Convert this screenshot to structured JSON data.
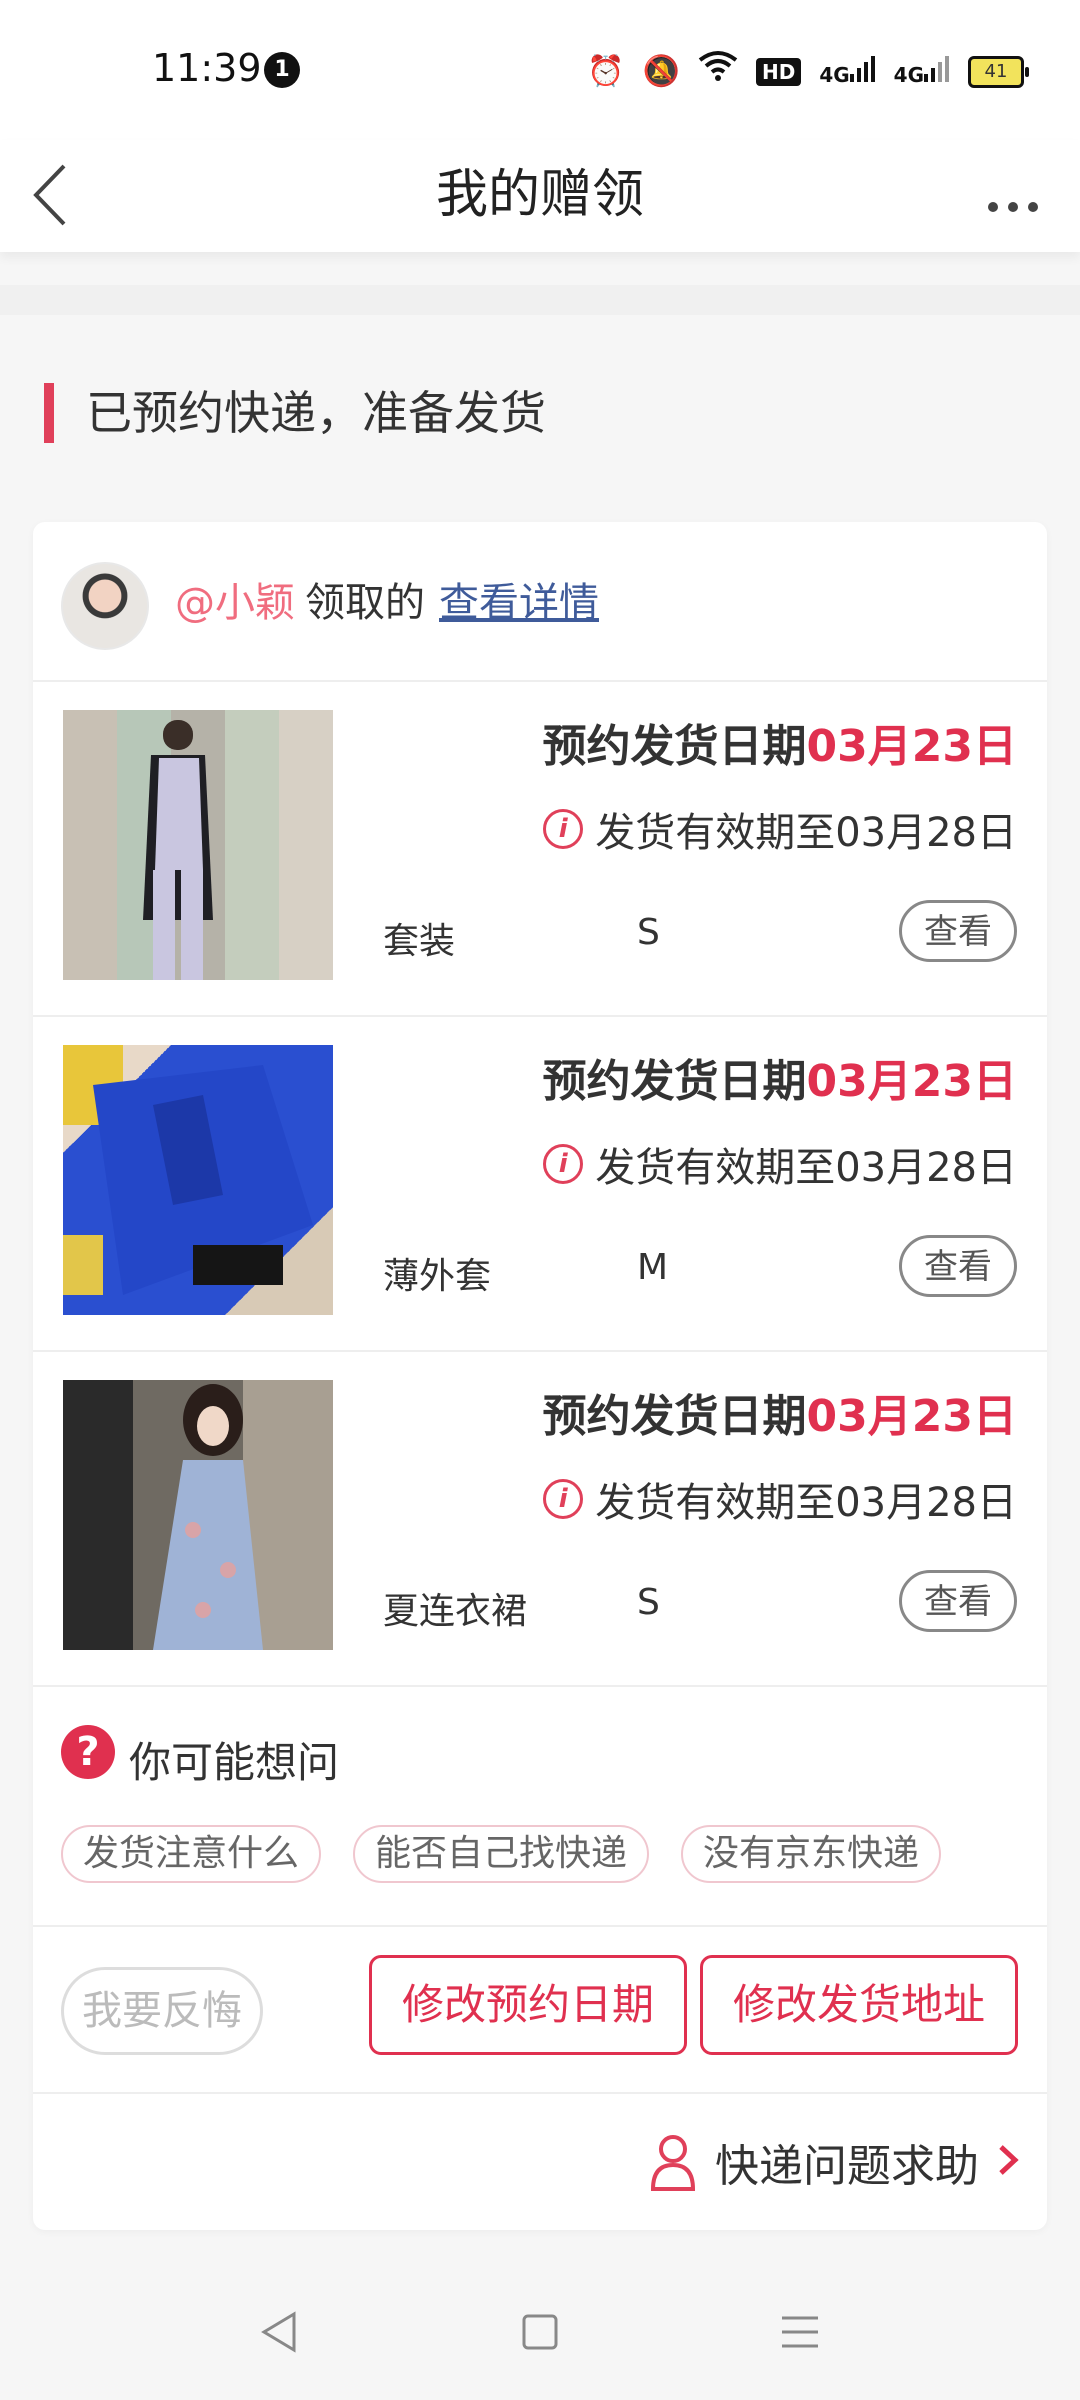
{
  "status": {
    "time": "11:39",
    "notif_count": "1",
    "network": "4G",
    "network2": "4G",
    "hd": "HD",
    "battery": "41"
  },
  "header": {
    "title": "我的赠领"
  },
  "section": {
    "title": "已预约快递，准备发货"
  },
  "claim": {
    "user": "@小颖",
    "middle": "领取的",
    "link": "查看详情"
  },
  "items": [
    {
      "ship_label": "预约发货日期",
      "ship_date": "03月23日",
      "valid": "发货有效期至03月28日",
      "name": "套装",
      "size": "S",
      "view": "查看"
    },
    {
      "ship_label": "预约发货日期",
      "ship_date": "03月23日",
      "valid": "发货有效期至03月28日",
      "name": "薄外套",
      "size": "M",
      "view": "查看"
    },
    {
      "ship_label": "预约发货日期",
      "ship_date": "03月23日",
      "valid": "发货有效期至03月28日",
      "name": "夏连衣裙",
      "size": "S",
      "view": "查看"
    }
  ],
  "faq": {
    "title": "你可能想问",
    "chips": [
      "发货注意什么",
      "能否自己找快递",
      "没有京东快递"
    ]
  },
  "actions": {
    "regret": "我要反悔",
    "change_date": "修改预约日期",
    "change_address": "修改发货地址"
  },
  "help": {
    "label": "快递问题求助"
  },
  "colors": {
    "accent": "#e0304f",
    "link": "#3f5b9a",
    "user": "#f06d7f"
  }
}
